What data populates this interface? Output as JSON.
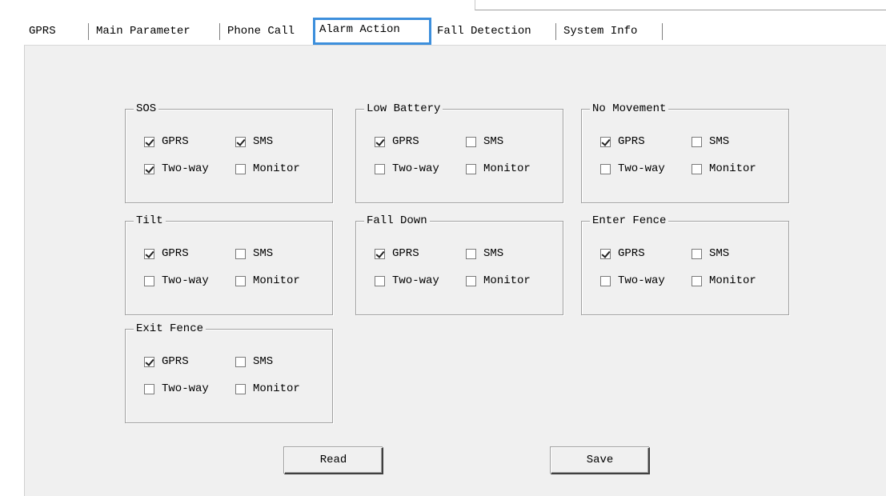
{
  "tabs": [
    {
      "label": "GPRS"
    },
    {
      "label": "Main Parameter"
    },
    {
      "label": "Phone Call"
    },
    {
      "label": "Alarm Action",
      "active": true
    },
    {
      "label": "Fall Detection"
    },
    {
      "label": "System Info"
    }
  ],
  "option_labels": {
    "gprs": "GPRS",
    "sms": "SMS",
    "twoway": "Two-way",
    "monitor": "Monitor"
  },
  "groups": [
    {
      "title": "SOS",
      "gprs": true,
      "sms": true,
      "twoway": true,
      "monitor": false
    },
    {
      "title": "Low Battery",
      "gprs": true,
      "sms": false,
      "twoway": false,
      "monitor": false
    },
    {
      "title": "No Movement",
      "gprs": true,
      "sms": false,
      "twoway": false,
      "monitor": false
    },
    {
      "title": "Tilt",
      "gprs": true,
      "sms": false,
      "twoway": false,
      "monitor": false
    },
    {
      "title": "Fall Down",
      "gprs": true,
      "sms": false,
      "twoway": false,
      "monitor": false
    },
    {
      "title": "Enter Fence",
      "gprs": true,
      "sms": false,
      "twoway": false,
      "monitor": false
    },
    {
      "title": "Exit Fence",
      "gprs": true,
      "sms": false,
      "twoway": false,
      "monitor": false
    }
  ],
  "buttons": {
    "read": "Read",
    "save": "Save"
  },
  "colors": {
    "tab_highlight": "#3d8fdc",
    "panel_bg": "#f0f0f0"
  }
}
